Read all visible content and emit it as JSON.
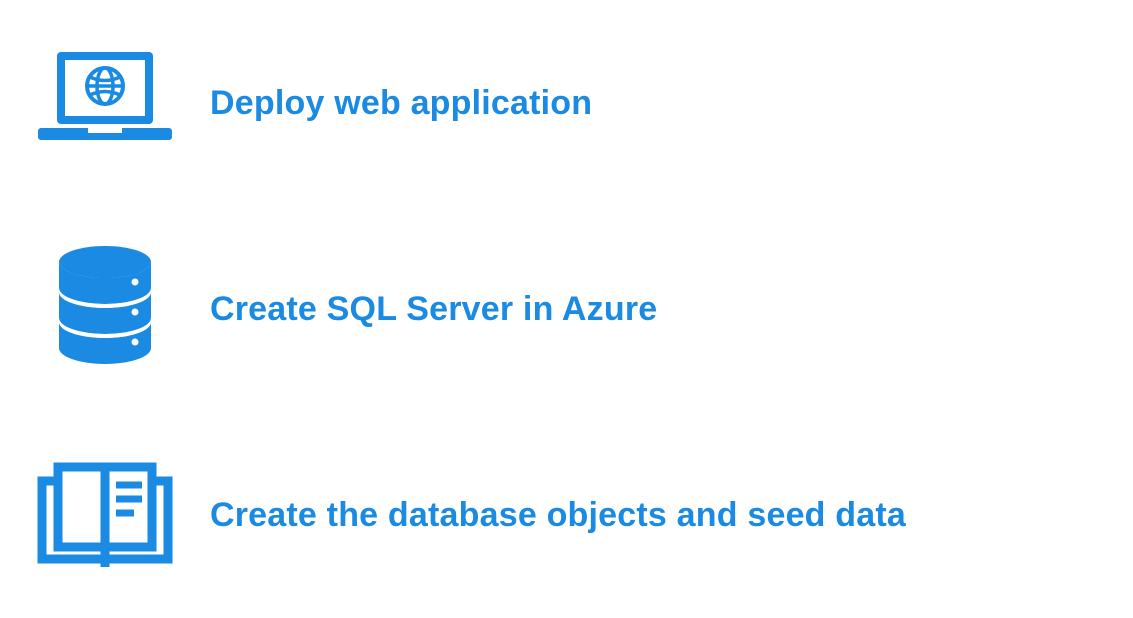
{
  "accent": "#1a8ae2",
  "items": [
    {
      "icon": "laptop-globe-icon",
      "label": "Deploy web application"
    },
    {
      "icon": "database-icon",
      "label": "Create SQL Server in Azure"
    },
    {
      "icon": "open-book-icon",
      "label": "Create the database objects and seed data"
    }
  ]
}
